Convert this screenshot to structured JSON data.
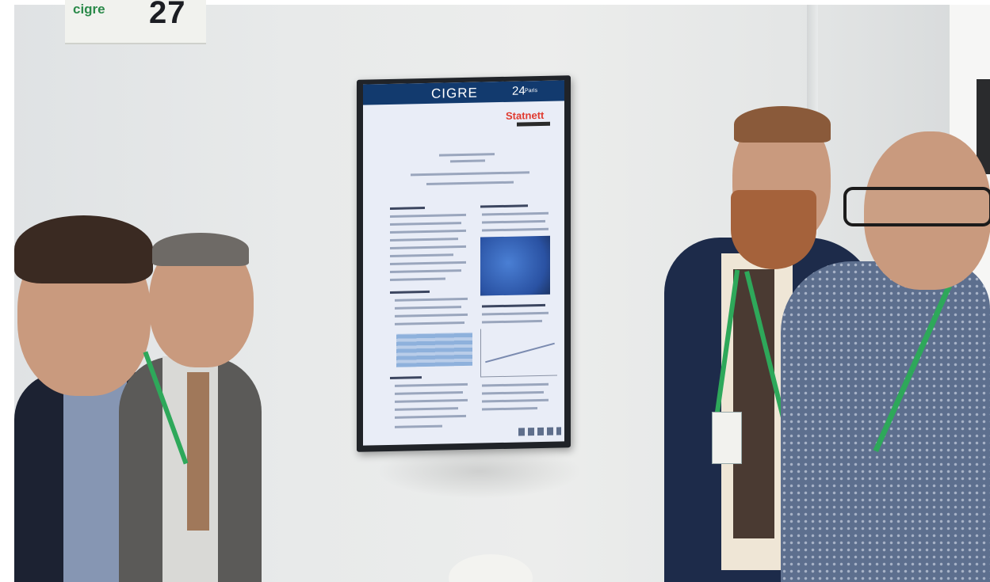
{
  "scene": {
    "sign": {
      "logo_text": "cigre",
      "number": "27"
    },
    "monitor": {
      "banner_text": "CIGRE",
      "banner_number": "24",
      "banner_city": "Paris",
      "logo_text": "Statnett"
    }
  },
  "colors": {
    "wall": "#e8eaea",
    "monitor_bezel": "#202328",
    "screen_background": "#e9edf7",
    "banner": "#123a6e",
    "statnett_red": "#e03a2f",
    "lanyard_green": "#2ea85a"
  }
}
